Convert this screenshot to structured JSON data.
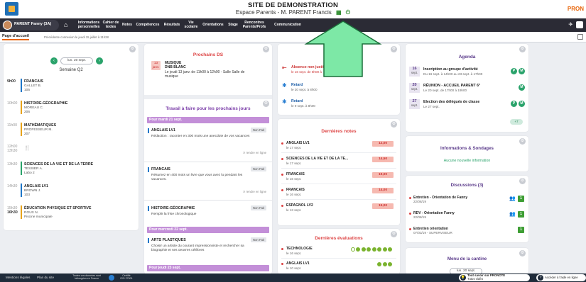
{
  "header": {
    "site_title": "SITE DE DEMONSTRATION",
    "site_subtitle": "Espace Parents - M. PARENT Francis",
    "brand": "PRON"
  },
  "nav": {
    "user": "PARENT Fanny (3A)",
    "items": [
      {
        "label": "Informations personnelles"
      },
      {
        "label": "Cahier de textes"
      },
      {
        "label": "Notes"
      },
      {
        "label": "Compétences"
      },
      {
        "label": "Résultats"
      },
      {
        "label": "Vie scolaire"
      },
      {
        "label": "Orientations"
      },
      {
        "label": "Stage"
      },
      {
        "label": "Rencontres Parents/Profs"
      },
      {
        "label": "Communication"
      }
    ]
  },
  "crumbs": {
    "active": "Page d'accueil",
    "previous": "Précédente connexion le jeudi 15 juillet à 11h28"
  },
  "schedule": {
    "date": "lun. 20 sept.",
    "week": "Semaine Q2",
    "slots": [
      {
        "time": "9h00",
        "subject": "FRANCAIS",
        "teacher": "GALLET B.",
        "room": "105"
      },
      {
        "time": "10h00",
        "subject": "HISTOIRE-GÉOGRAPHIE",
        "teacher": "MOREAU C.",
        "room": "206"
      },
      {
        "time": "11h00",
        "subject": "MATHÉMATIQUES",
        "teacher": "PROFESSEUR M.",
        "room": "207"
      },
      {
        "time": "12h00",
        "time2": "13h30",
        "subject": "",
        "teacher": "",
        "room": ""
      },
      {
        "time": "13h30",
        "subject": "SCIENCES DE LA VIE ET DE LA TERRE",
        "teacher": "TESSIER A.",
        "room": "Labo 2"
      },
      {
        "time": "14h30",
        "subject": "ANGLAIS LV1",
        "teacher": "BROWN J.",
        "room": "103"
      },
      {
        "time": "15h30",
        "time2": "16h30",
        "subject": "ÉDUCATION PHYSIQUE ET SPORTIVE",
        "teacher": "ROUX N.",
        "room": "Piscine municipale"
      }
    ]
  },
  "ds": {
    "title": "Prochains DS",
    "date_day": "13",
    "date_month": "janv.",
    "subject": "MUSIQUE",
    "exam": "DNB BLANC",
    "desc1": "Le jeudi 13 janv. de 11h00 à 12h00 - Salle Salle de",
    "desc2": "musique"
  },
  "homework": {
    "title": "Travail à faire pour les prochains jours",
    "days": [
      {
        "label": "Pour mardi 21 sept."
      },
      {
        "label": "Pour mercredi 22 sept."
      },
      {
        "label": "Pour jeudi 23 sept."
      }
    ],
    "items": [
      {
        "subject": "ANGLAIS LV1",
        "status": "Non Fait",
        "desc": "Rédaction : raconter en 300 mots une anecdote de vos vacances",
        "due": "À rendre en ligne"
      },
      {
        "subject": "FRANCAIS",
        "status": "Non Fait",
        "desc": "Résumez en 400 mots un livre que vous avez lu pendant les vacances.",
        "due": "À rendre en ligne"
      },
      {
        "subject": "HISTOIRE-GÉOGRAPHIE",
        "status": "Non Fait",
        "desc": "Remplir la frise chronologique",
        "due": ""
      },
      {
        "subject": "ARTS PLASTIQUES",
        "status": "Non Fait",
        "desc": "Choisir un artiste du courant impressionniste et rechercher sa biographie et ses oeuvres célèbres",
        "due": ""
      }
    ]
  },
  "vie_scolaire": {
    "items": [
      {
        "title": "Absence non justifiée",
        "date": "le 16 sept. de 8h00 à"
      },
      {
        "title": "Retard",
        "date": "le 20 sept. à 8h00"
      },
      {
        "title": "Retard",
        "date": "le 9 sept. à 8h00"
      }
    ]
  },
  "notes": {
    "title": "Dernières notes",
    "items": [
      {
        "subject": "ANGLAIS LV1",
        "date": "le 17 sept.",
        "value": "12,00"
      },
      {
        "subject": "SCIENCES DE LA VIE ET DE LA TE...",
        "date": "le 17 sept.",
        "value": "14,50"
      },
      {
        "subject": "FRANCAIS",
        "date": "le 16 sept.",
        "value": "19,00"
      },
      {
        "subject": "FRANCAIS",
        "date": "le 16 sept.",
        "value": "14,00"
      },
      {
        "subject": "ESPAGNOL LV2",
        "date": "le 13 sept.",
        "value": "15,00"
      }
    ]
  },
  "evaluations": {
    "title": "Dernières évaluations",
    "items": [
      {
        "subject": "TECHNOLOGIE",
        "date": "le 16 sept."
      },
      {
        "subject": "ANGLAIS LV1",
        "date": "le 10 sept."
      }
    ]
  },
  "agenda": {
    "title": "Agenda",
    "items": [
      {
        "day": "16",
        "month": "sept.",
        "title": "Inscription au groupe d'activité",
        "date": "Du 16 sept. à 14h00 au 23 sept. à 17h00",
        "pills": [
          "P",
          "M"
        ]
      },
      {
        "day": "20",
        "month": "sept.",
        "title": "RÉUNION - ACCUEIL PARENT 6°",
        "date": "Le 20 sept. de 17h00 à 19h00",
        "pills": [
          "M"
        ]
      },
      {
        "day": "27",
        "month": "sept.",
        "title": "Election des délégués de classe",
        "date": "Le 27 sept.",
        "pills": [
          "P",
          "M"
        ]
      }
    ],
    "more": "+7"
  },
  "infos": {
    "title": "Informations & Sondages",
    "subtitle": "Aucune nouvelle information"
  },
  "discussions": {
    "title": "Discussions (3)",
    "items": [
      {
        "title": "Entretien - Orientation de Fanny",
        "date": "22/08/19",
        "count": "1"
      },
      {
        "title": "RDV - Orientation Fanny",
        "date": "22/08/19",
        "count": "1"
      },
      {
        "title": "Entretien orientation",
        "date": "07/03/19 - SUPERVISEUR",
        "count": "1"
      }
    ]
  },
  "cantine": {
    "title": "Menu de la cantine",
    "date": "lun. 20 sept."
  },
  "footer": {
    "mentions": "Mentions légales",
    "plan": "Plan du site",
    "hosted_1": "Toutes vos données sont",
    "hosted_2": "hébergées en France",
    "cert_1": "Certifié",
    "cert_2": "ISO 27001",
    "tout_1": "Tout savoir sur PRONOTE",
    "tout_2": "Tutos vidéo",
    "aide": "Accéder à l'aide en ligne"
  },
  "colors": {
    "accent": "#2aa36b",
    "nav": "#2b2b35",
    "alert": "#d44444",
    "arrow": "#7de8a6"
  }
}
